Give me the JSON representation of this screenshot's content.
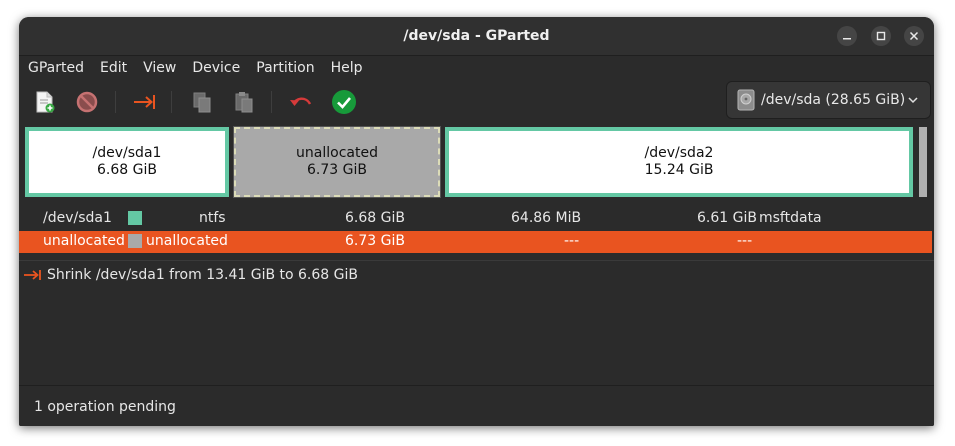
{
  "window": {
    "title": "/dev/sda - GParted"
  },
  "menu": [
    "GParted",
    "Edit",
    "View",
    "Device",
    "Partition",
    "Help"
  ],
  "toolbar": {
    "device": "/dev/sda (28.65 GiB)"
  },
  "graph": {
    "sda1": {
      "name": "/dev/sda1",
      "size": "6.68 GiB"
    },
    "unallocated": {
      "name": "unallocated",
      "size": "6.73 GiB"
    },
    "sda2": {
      "name": "/dev/sda2",
      "size": "15.24 GiB"
    }
  },
  "partitions": [
    {
      "partition": "/dev/sda1",
      "filesystem": "ntfs",
      "size": "6.68 GiB",
      "used": "64.86 MiB",
      "unused": "6.61 GiB",
      "flags": "msftdata",
      "swatch": "#64c8a4"
    },
    {
      "partition": "unallocated",
      "filesystem": "unallocated",
      "size": "6.73 GiB",
      "used": "---",
      "unused": "---",
      "flags": "",
      "swatch": "#a9a9a9"
    }
  ],
  "operations": [
    {
      "text": "Shrink /dev/sda1 from 13.41 GiB to 6.68 GiB"
    }
  ],
  "status": "1 operation pending",
  "colors": {
    "selection": "#e95420",
    "ntfs": "#64c8a4",
    "unallocated": "#a9a9a9"
  }
}
